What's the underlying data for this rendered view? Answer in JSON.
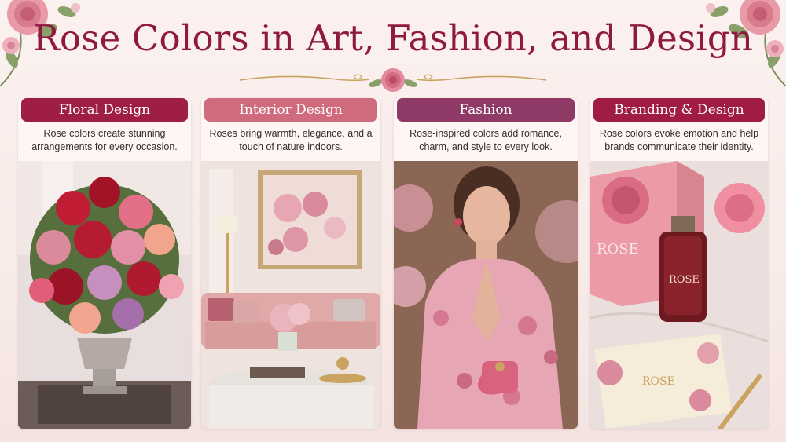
{
  "title": "Rose Colors in Art, Fashion, and Design",
  "colors": {
    "title": "#8e1a3f",
    "floral_header": "#9e1f43",
    "interior_header": "#d06b7e",
    "fashion_header": "#8f3a66",
    "branding_header": "#a01c45"
  },
  "icons": [
    "rose-icon",
    "floral-corner-icon"
  ],
  "cards": [
    {
      "heading": "Floral Design",
      "description": "Rose colors create stunning arrangements for every occasion.",
      "image": "rose-bouquet-vase-image"
    },
    {
      "heading": "Interior Design",
      "description": "Roses bring warmth, elegance, and a touch of nature indoors.",
      "image": "pink-living-room-image"
    },
    {
      "heading": "Fashion",
      "description": "Rose-inspired colors add romance, charm, and style to every look.",
      "image": "floral-dress-model-image"
    },
    {
      "heading": "Branding & Design",
      "description": "Rose colors evoke emotion and help brands communicate their identity.",
      "image": "rose-perfume-branding-image",
      "brand_text": "ROSE"
    }
  ]
}
